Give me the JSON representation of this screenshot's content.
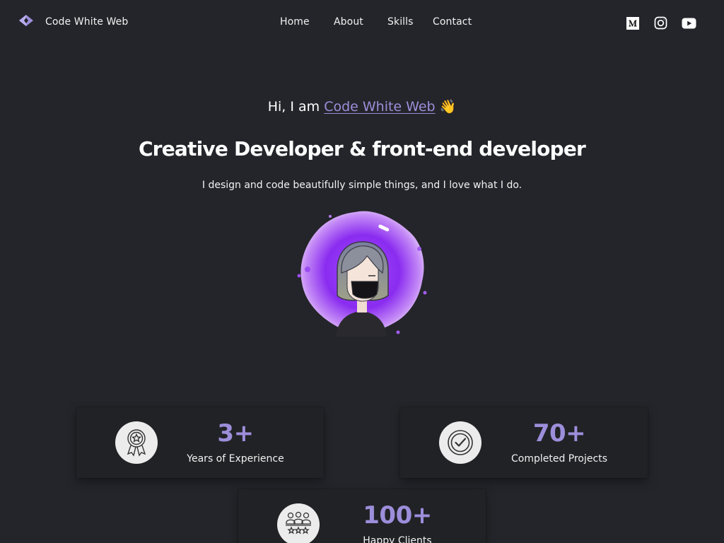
{
  "header": {
    "brand": "Code White Web",
    "nav": [
      "Home",
      "About",
      "Skills",
      "Contact"
    ],
    "social_icons": [
      "medium-icon",
      "instagram-icon",
      "youtube-icon"
    ]
  },
  "hero": {
    "greeting_prefix": "Hi, I am ",
    "greeting_name": "Code White Web",
    "greeting_emoji": "👋",
    "headline": "Creative Developer & front-end developer",
    "subtitle": "I design and code beautifully simple things, and I love what I do."
  },
  "stats": [
    {
      "value": "3+",
      "label": "Years of Experience",
      "icon": "award-ribbon-icon"
    },
    {
      "value": "70+",
      "label": "Completed Projects",
      "icon": "check-circle-icon"
    },
    {
      "value": "100+",
      "label": "Happy Clients",
      "icon": "clients-group-icon"
    }
  ],
  "colors": {
    "background": "#24252a",
    "card": "#212226",
    "accent": "#9d8edb",
    "text": "#f2f2f2"
  }
}
